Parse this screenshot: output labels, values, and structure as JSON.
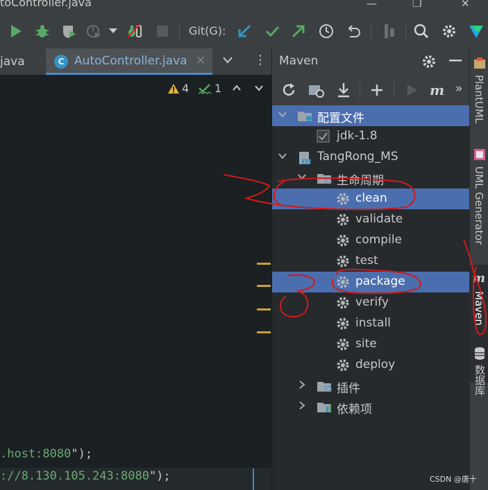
{
  "window": {
    "title": "toController.java",
    "minimize_glyph": "—",
    "maximize_glyph": "❐",
    "close_glyph": "✕"
  },
  "toolbar": {
    "git_label": "Git(G):",
    "icons": [
      "run-icon",
      "debug-icon",
      "coverage-icon",
      "profile-icon",
      "more-run-dropdown-icon",
      "attach-debugger-icon",
      "stop-icon",
      "git-update-icon",
      "git-commit-icon",
      "git-push-icon",
      "git-history-icon",
      "git-rollback-icon",
      "vcs-branches-icon",
      "search-everywhere-icon",
      "settings-icon",
      "plugin-logo-icon"
    ]
  },
  "editor_tabs": {
    "prev_tab_label": "java",
    "active_tab_label": "AutoController.java",
    "active_tab_icon_letter": "C",
    "close_glyph": "×",
    "dropdown_glyph": "⌄",
    "more_glyph": "⋮"
  },
  "editor": {
    "warnings_count": "4",
    "typos_count": "1",
    "line1_text": ".host:8080",
    "line1_suffix": "\");",
    "line1_prefix": "",
    "line2_text": "://8.130.105.243:8080",
    "line2_suffix": "\");"
  },
  "maven": {
    "title": "Maven",
    "tree": [
      {
        "label": "配置文件",
        "level": 0,
        "expanded": true,
        "selected": true,
        "icon": "profiles-folder-icon"
      },
      {
        "label": "jdk-1.8",
        "level": 1,
        "checkbox": true,
        "icon": "checkbox-icon"
      },
      {
        "label": "TangRong_MS",
        "level": 0,
        "expanded": true,
        "icon": "maven-project-icon"
      },
      {
        "label": "生命周期",
        "level": 1,
        "expanded": true,
        "icon": "lifecycle-folder-icon"
      },
      {
        "label": "clean",
        "level": 2,
        "selected": true,
        "icon": "gear-icon"
      },
      {
        "label": "validate",
        "level": 2,
        "icon": "gear-icon"
      },
      {
        "label": "compile",
        "level": 2,
        "icon": "gear-icon"
      },
      {
        "label": "test",
        "level": 2,
        "icon": "gear-icon"
      },
      {
        "label": "package",
        "level": 2,
        "selected": true,
        "icon": "gear-icon"
      },
      {
        "label": "verify",
        "level": 2,
        "icon": "gear-icon"
      },
      {
        "label": "install",
        "level": 2,
        "icon": "gear-icon"
      },
      {
        "label": "site",
        "level": 2,
        "icon": "gear-icon"
      },
      {
        "label": "deploy",
        "level": 2,
        "icon": "gear-icon"
      },
      {
        "label": "插件",
        "level": 1,
        "expanded": false,
        "icon": "plugins-folder-icon"
      },
      {
        "label": "依赖项",
        "level": 1,
        "expanded": false,
        "icon": "dependencies-folder-icon"
      }
    ],
    "toolbar_overflow": "»"
  },
  "right_strip": {
    "tabs": [
      "PlantUML",
      "UML Generator",
      "Maven",
      "数据库"
    ],
    "active": "Maven"
  },
  "watermark": "CSDN @唐十",
  "colors": {
    "selection": "#4b6eaf",
    "accent": "#4a88c7",
    "annotation_red": "#d11a1a",
    "run_green": "#59a869",
    "git_blue": "#3592c4"
  }
}
